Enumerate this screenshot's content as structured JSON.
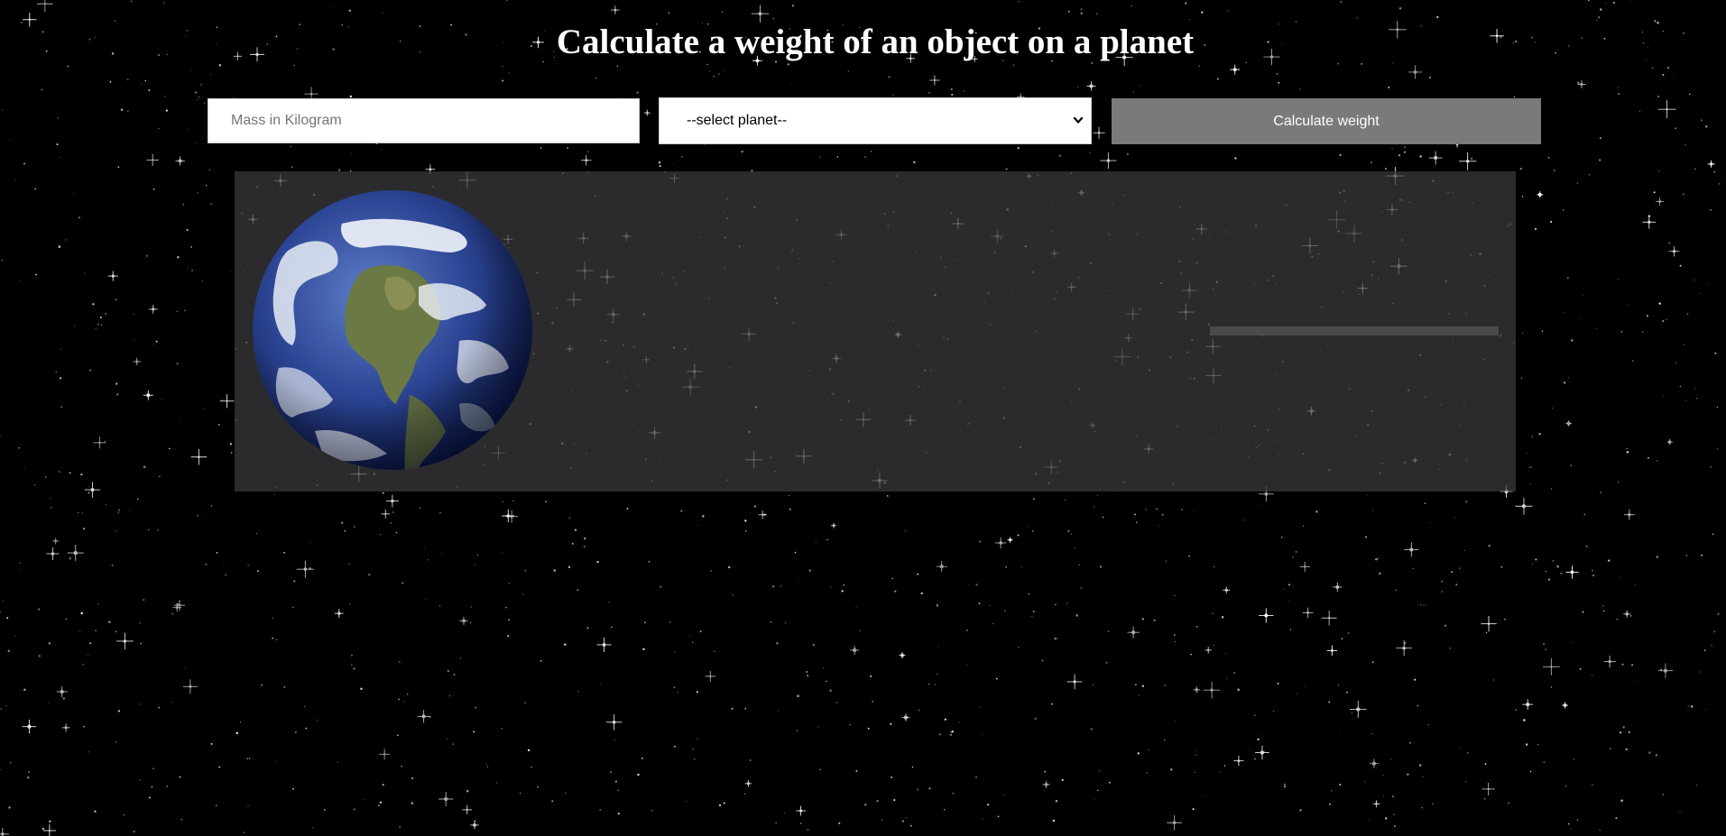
{
  "page": {
    "title": "Calculate a weight of an object on a planet"
  },
  "form": {
    "mass_placeholder": "Mass in Kilogram",
    "mass_value": "",
    "planet_selected": "--select planet--",
    "calculate_label": "Calculate weight"
  },
  "result": {
    "planet_icon": "earth-globe",
    "text": ""
  },
  "colors": {
    "background": "#000000",
    "button": "#7a7a7a",
    "panel": "#3c3c40"
  }
}
